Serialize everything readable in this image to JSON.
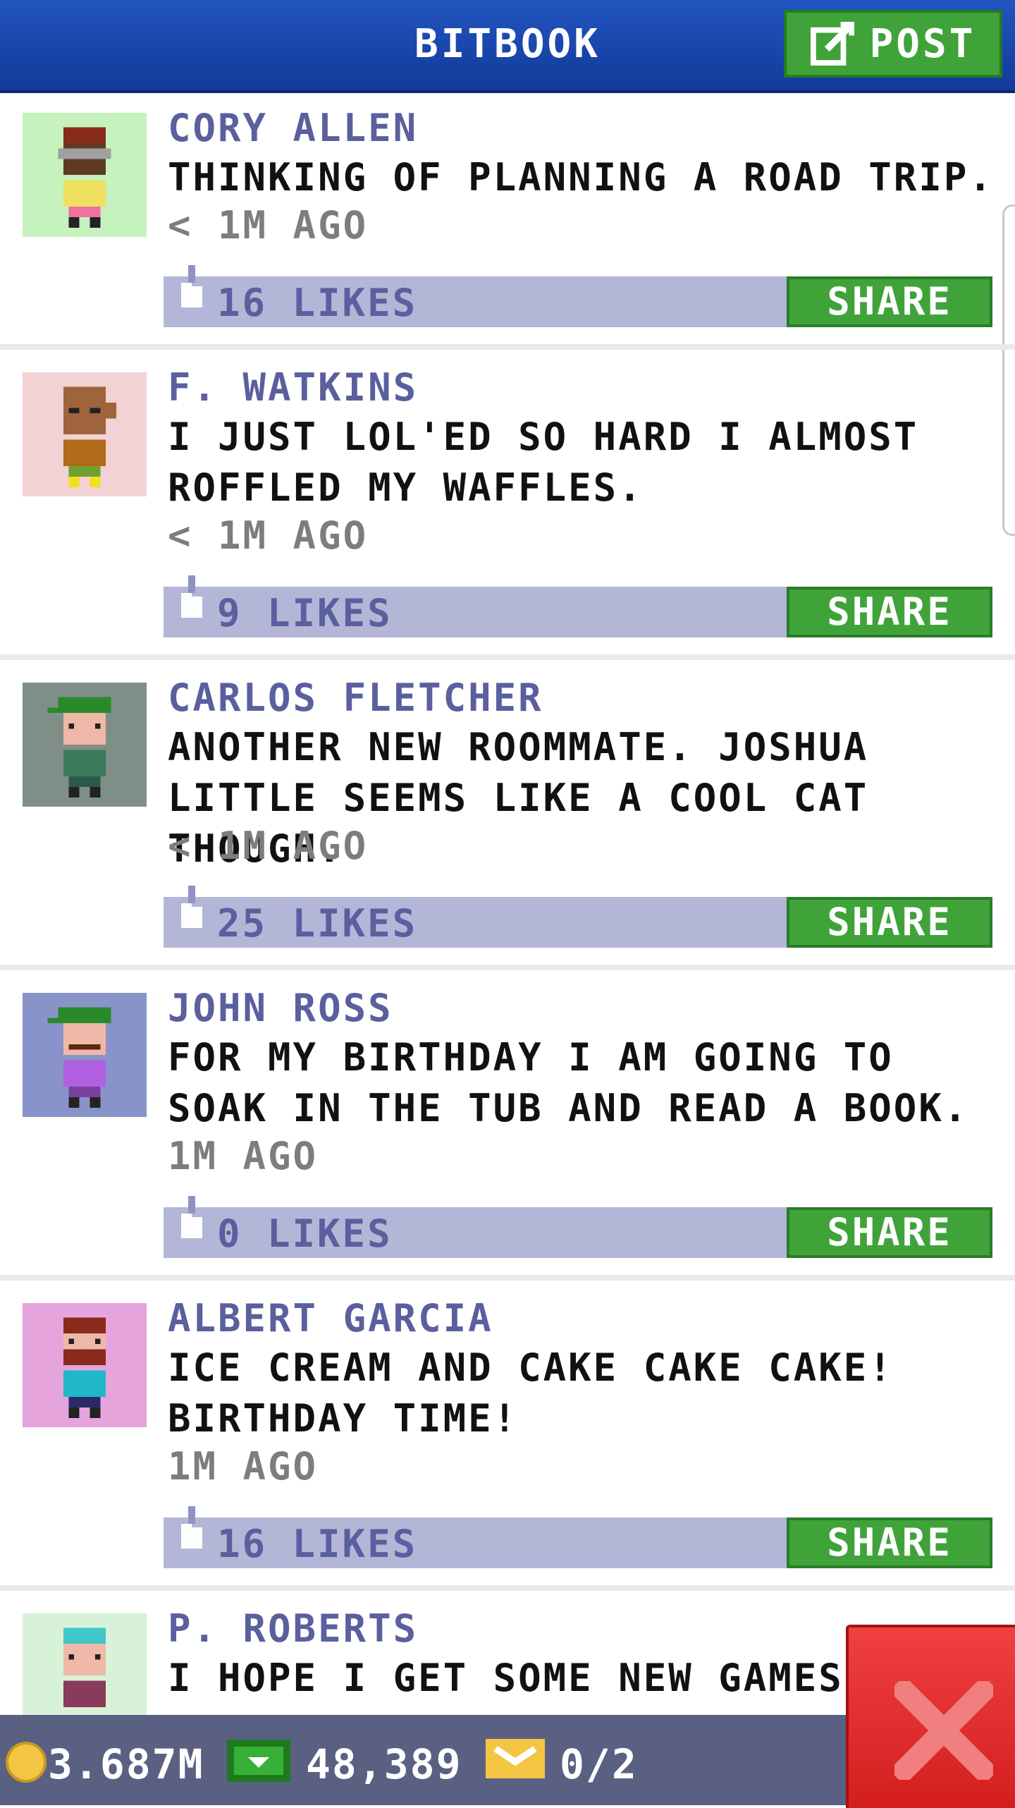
{
  "header": {
    "title": "BITBOOK",
    "post_label": "POST"
  },
  "colors": {
    "header_blue": "#1d4db0",
    "green": "#3fa33a",
    "likebar": "#b4b6d8",
    "name": "#5a5f9e",
    "close_red": "#e62a2a"
  },
  "posts": [
    {
      "name": "CORY ALLEN",
      "lines": [
        "THINKING OF PLANNING A ROAD TRIP."
      ],
      "time": "< 1M AGO",
      "likes": "16 LIKES",
      "share": "SHARE",
      "avatar_bg": "#c6f2bd"
    },
    {
      "name": "F. WATKINS",
      "lines": [
        "I JUST LOL'ED SO HARD I ALMOST",
        "ROFFLED MY WAFFLES."
      ],
      "time": "< 1M AGO",
      "likes": "9 LIKES",
      "share": "SHARE",
      "avatar_bg": "#f2d2d2"
    },
    {
      "name": "CARLOS FLETCHER",
      "lines": [
        "ANOTHER NEW ROOMMATE. JOSHUA",
        "LITTLE SEEMS LIKE A COOL CAT THOUGH."
      ],
      "time": "< 1M AGO",
      "likes": "25 LIKES",
      "share": "SHARE",
      "avatar_bg": "#7f8f88"
    },
    {
      "name": "JOHN ROSS",
      "lines": [
        "FOR MY BIRTHDAY I AM GOING TO",
        "SOAK IN THE TUB AND READ A BOOK."
      ],
      "time": "1M AGO",
      "likes": "0 LIKES",
      "share": "SHARE",
      "avatar_bg": "#8894c9"
    },
    {
      "name": "ALBERT GARCIA",
      "lines": [
        "ICE CREAM AND CAKE CAKE CAKE!",
        "BIRTHDAY TIME!"
      ],
      "time": "1M AGO",
      "likes": "16 LIKES",
      "share": "SHARE",
      "avatar_bg": "#e6a4dc"
    },
    {
      "name": "P. ROBERTS",
      "lines": [
        "I HOPE I GET SOME NEW GAMES F"
      ],
      "avatar_bg": "#d8f2d8"
    }
  ],
  "status": {
    "coins": "3.687M",
    "cash": "48,389",
    "tickets": "0/2"
  }
}
